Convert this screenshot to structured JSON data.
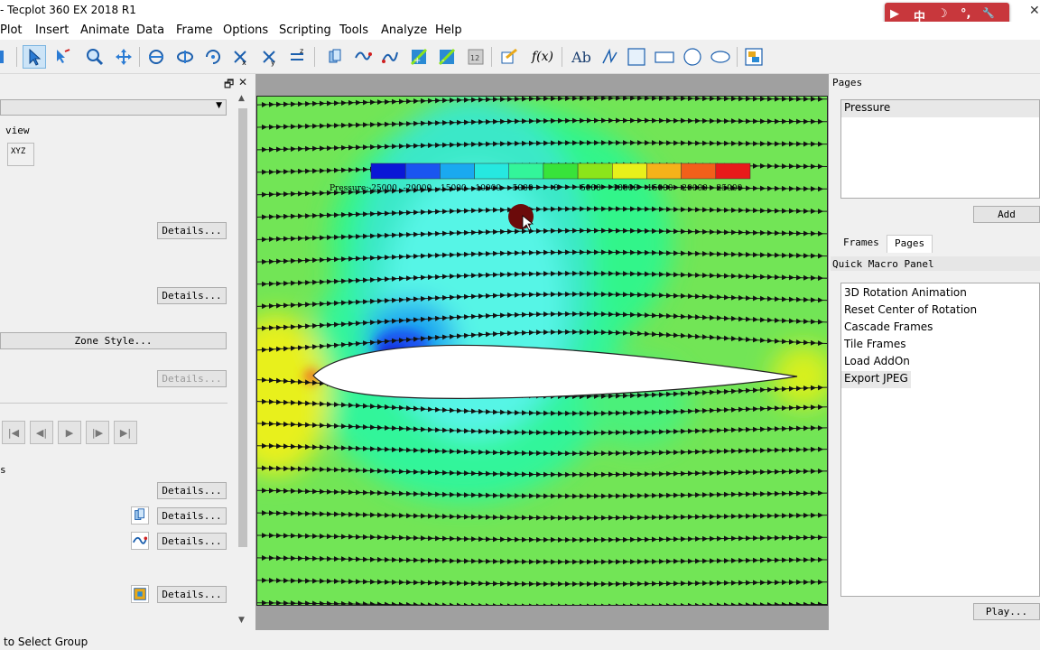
{
  "window": {
    "title": "- Tecplot 360 EX 2018 R1",
    "close_glyph": "✕"
  },
  "ime": {
    "items": [
      "中",
      "☽",
      "°,",
      "🔧"
    ]
  },
  "menu": [
    "Plot",
    "Insert",
    "Animate",
    "Data",
    "Frame",
    "Options",
    "Scripting",
    "Tools",
    "Analyze",
    "Help"
  ],
  "toolbar": {
    "text_tool": "Ab",
    "fx_tool": "f(x)",
    "tools": [
      "select-arrow-icon",
      "adjustor-icon",
      "zoom-icon",
      "translate-icon",
      "rotate-icon",
      "rotate-x-icon",
      "rotate-y-icon",
      "rotate-z-icon",
      "slice-icon",
      "probe-icon",
      "streamtrace-icon",
      "contour-add-icon",
      "contour-remove-icon",
      "numbered-icon",
      "mesh-icon",
      "fx-icon",
      "text-icon",
      "polyline-icon",
      "square-icon",
      "rectangle-icon",
      "circle-icon",
      "ellipse-icon",
      "frame-icon"
    ]
  },
  "sidebar": {
    "pin_glyph": "🗗",
    "close_glyph": "✕",
    "view_label": "view",
    "axis_label": "XYZ",
    "details_label": "Details...",
    "zone_style_label": "Zone Style...",
    "s_label": "s",
    "anim_controls": [
      "|◀",
      "◀|",
      "▶",
      "|▶",
      "▶|"
    ]
  },
  "chart_data": {
    "type": "contour",
    "legend_title": "Pressure:",
    "levels": [
      -25000,
      -20000,
      -15000,
      -10000,
      -5000,
      0,
      5000,
      10000,
      15000,
      20000,
      25000
    ],
    "colors": [
      "#0a17d6",
      "#1a55f0",
      "#1aa9f0",
      "#26e8e0",
      "#33f59a",
      "#38e33a",
      "#8ce51a",
      "#e8f01a",
      "#f5b21a",
      "#f2601a",
      "#e81a1a"
    ]
  },
  "pages_panel": {
    "title": "Pages",
    "items": [
      "Pressure"
    ],
    "add_label": "Add"
  },
  "tabs": [
    "Frames",
    "Pages"
  ],
  "macro_panel": {
    "title": "Quick Macro Panel",
    "items": [
      "3D Rotation Animation",
      "Reset Center of Rotation",
      "Cascade Frames",
      "Tile Frames",
      "Load AddOn",
      "Export JPEG"
    ],
    "play_label": "Play..."
  },
  "status": {
    "text": "to Select Group"
  }
}
